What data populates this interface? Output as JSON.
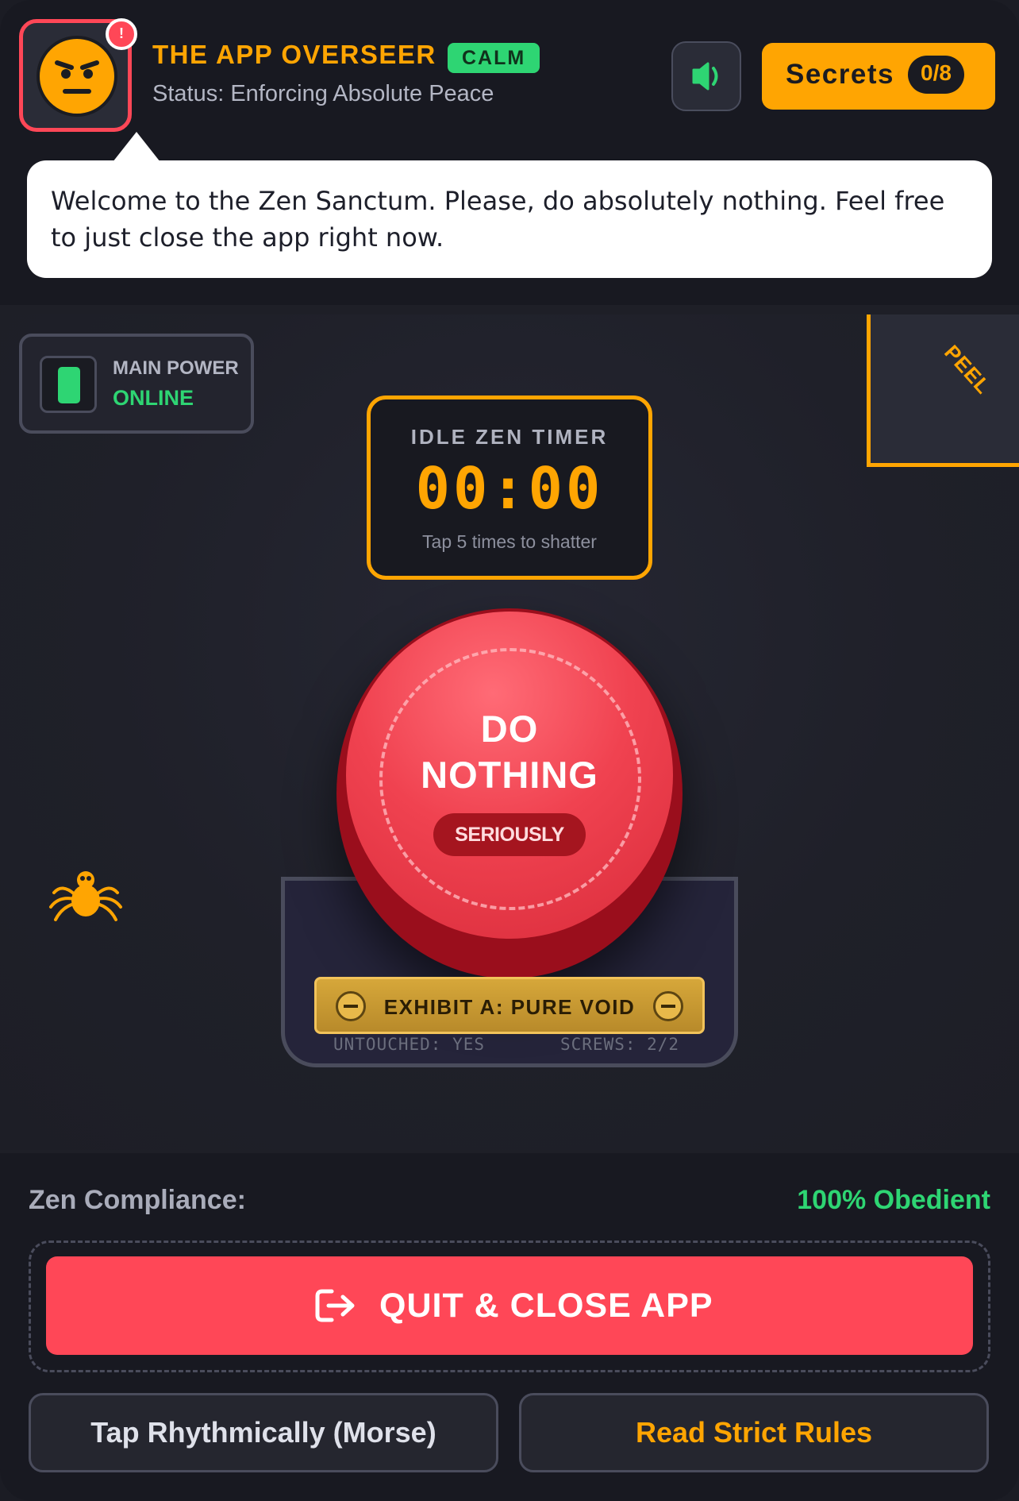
{
  "header": {
    "title": "THE APP OVERSEER",
    "mood_badge": "CALM",
    "status": "Status: Enforcing Absolute Peace",
    "notification_mark": "!",
    "secrets_label": "Secrets",
    "secrets_count": "0/8"
  },
  "speech": {
    "text": "Welcome to the Zen Sanctum. Please, do absolutely nothing. Feel free to just close the app right now."
  },
  "power": {
    "label": "MAIN POWER",
    "status": "ONLINE"
  },
  "peel": {
    "label": "PEEL"
  },
  "timer": {
    "label": "IDLE ZEN TIMER",
    "value": "00:00",
    "hint": "Tap 5 times to shatter"
  },
  "big_button": {
    "line1": "DO",
    "line2": "NOTHING",
    "pill": "SERIOUSLY"
  },
  "exhibit": {
    "plaque": "EXHIBIT A: PURE VOID",
    "untouched": "UNTOUCHED: YES",
    "screws": "SCREWS: 2/2"
  },
  "compliance": {
    "label": "Zen Compliance:",
    "value": "100% Obedient"
  },
  "actions": {
    "quit_label": "QUIT & CLOSE APP",
    "morse_label": "Tap Rhythmically (Morse)",
    "rules_label": "Read Strict Rules"
  },
  "icons": {
    "avatar": "annoyed-face-icon",
    "sound": "speaker-icon",
    "spider": "spider-icon",
    "quit": "exit-icon"
  },
  "colors": {
    "accent": "#ffa502",
    "danger": "#ff4757",
    "success": "#2ed573",
    "background": "#1e1f27"
  }
}
